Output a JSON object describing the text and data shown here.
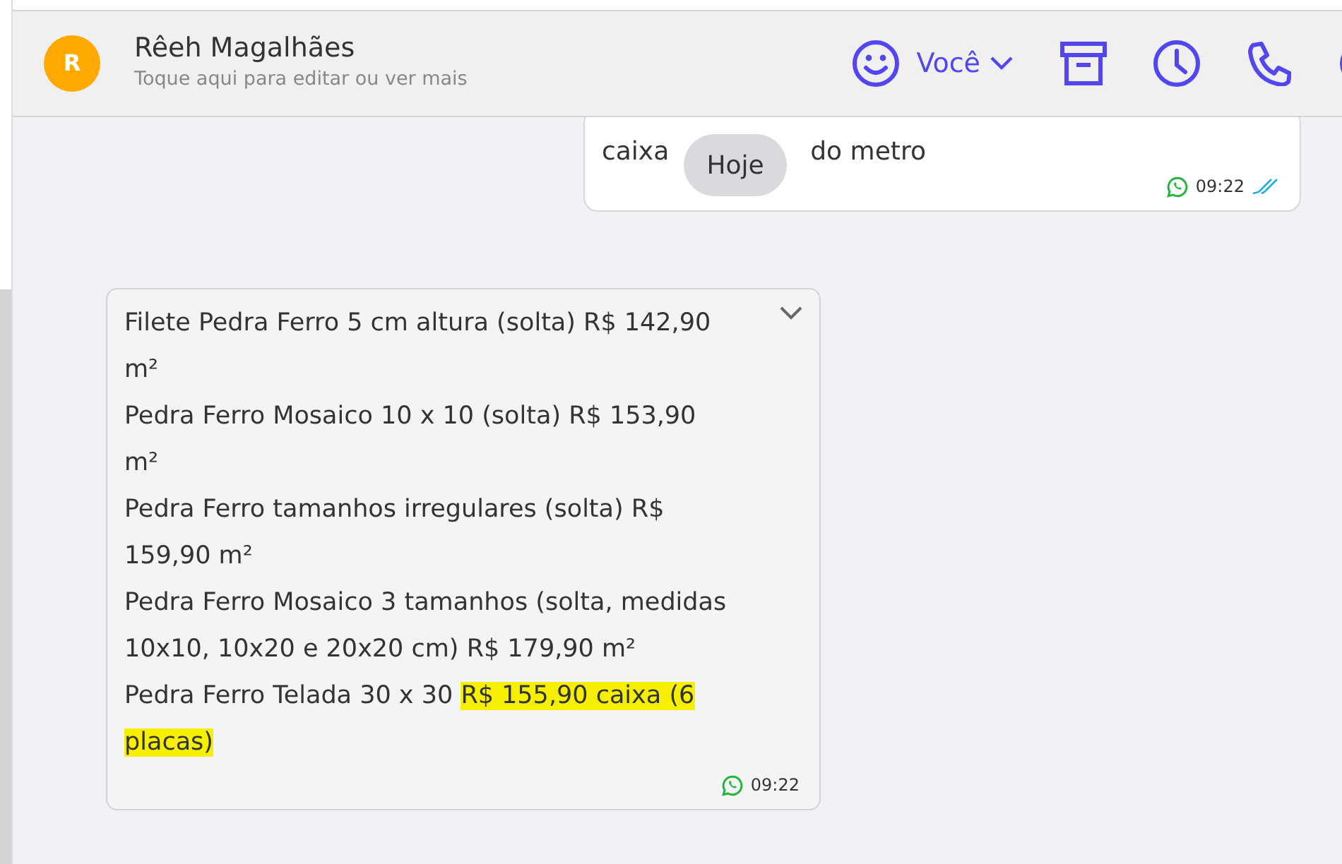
{
  "header": {
    "avatar_letter": "R",
    "name": "Rêeh Magalhães",
    "subtitle": "Toque aqui para editar ou ver mais",
    "agent": "Você"
  },
  "messages": [
    {
      "kind": "outgoing",
      "parts": [
        "caixa",
        "do metro"
      ],
      "time": "09:22",
      "read": true
    },
    {
      "kind": "incoming",
      "lines": [
        {
          "text": "Filete Pedra Ferro 5 cm altura (solta) R$ 142,90 m²"
        },
        {
          "text": "Pedra Ferro Mosaico 10 x 10 (solta) R$ 153,90 m²"
        },
        {
          "text": "Pedra Ferro tamanhos irregulares (solta) R$ 159,90 m²"
        },
        {
          "text": "Pedra Ferro Mosaico 3 tamanhos (solta, medidas 10x10, 10x20 e 20x20 cm) R$ 179,90 m²"
        },
        {
          "text": "Pedra Ferro Telada 30 x 30 ",
          "highlight": "R$ 155,90 caixa (6 placas)"
        }
      ],
      "time": "09:22"
    }
  ],
  "date_pill": "Hoje"
}
